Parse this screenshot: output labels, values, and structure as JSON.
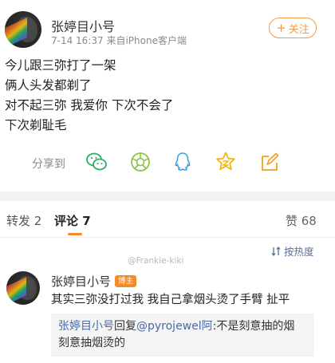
{
  "post": {
    "username": "张婷目小号",
    "time": "7-14 16:37",
    "source": "来自iPhone客户端",
    "follow_label": "关注",
    "content_lines": [
      "今儿跟三弥打了一架",
      "俩人头发都剃了",
      "对不起三弥 我爱你 下次不会了",
      "下次剃耻毛"
    ]
  },
  "share": {
    "label": "分享到",
    "icons": [
      "wechat-icon",
      "moments-icon",
      "qq-icon",
      "qzone-star-icon",
      "save-edit-icon"
    ]
  },
  "tabs": {
    "repost": "转发 2",
    "comment": "评论 7",
    "like": "赞 68"
  },
  "sort_label": "按热度",
  "watermark": "@Frankie-kiki",
  "comment": {
    "username": "张婷目小号",
    "badge": "博主",
    "text": "其实三弥没打过我 我自己拿烟头烫了手臂 扯平",
    "reply": {
      "author": "张婷目小号",
      "verb": "回复",
      "mention": "@pyrojewel阿",
      "text": ":不是刻意抽的烟 刻意抽烟烫的"
    }
  },
  "colors": {
    "accent": "#f28b2c",
    "link": "#4a6aa5",
    "divider": "#f2f2f2"
  }
}
